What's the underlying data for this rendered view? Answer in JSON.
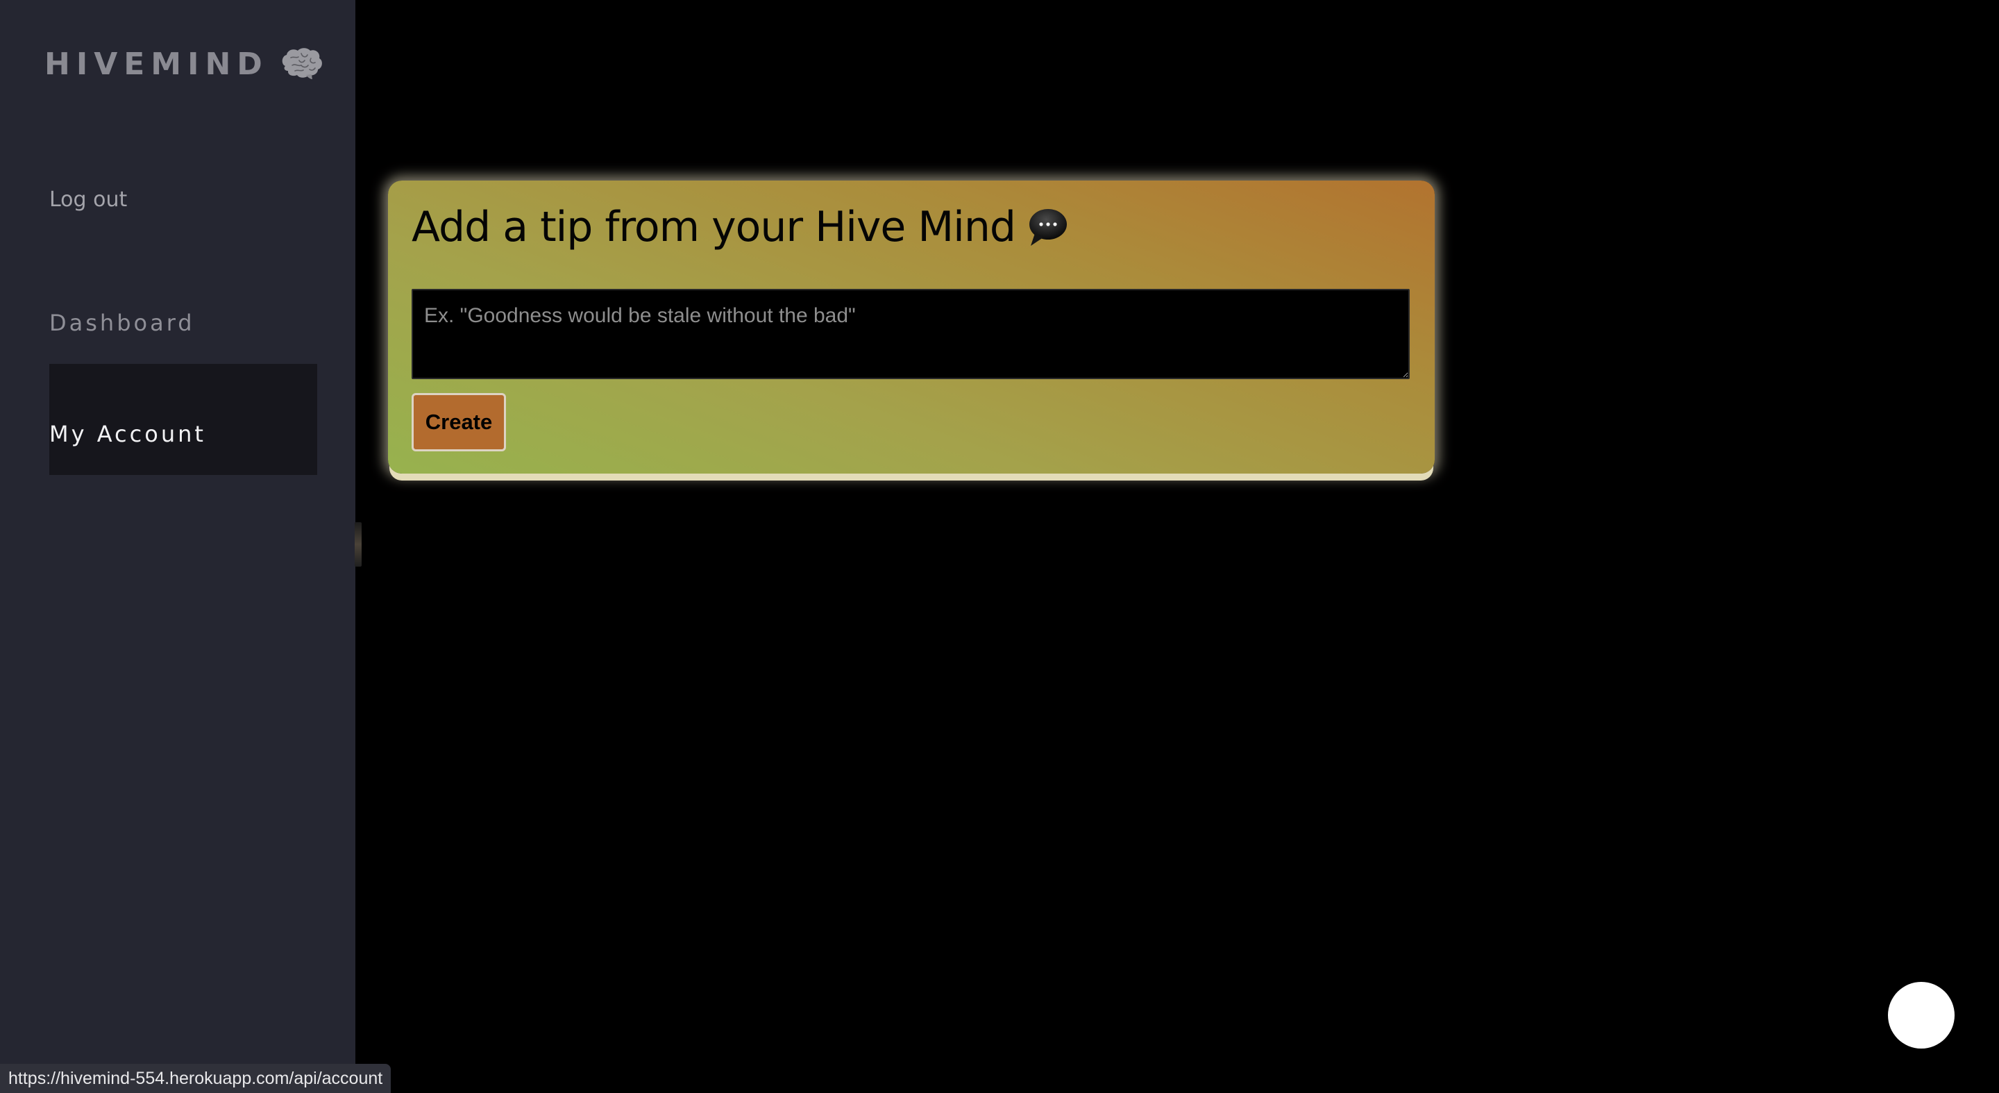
{
  "sidebar": {
    "brand": "HIVEMIND",
    "brand_icon": "brain-icon",
    "logout_label": "Log out",
    "nav": {
      "dashboard_label": "Dashboard",
      "account_label": "My Account"
    }
  },
  "tip_card": {
    "title": "Add a tip from your Hive Mind",
    "title_icon": "speech-bubble-icon",
    "input_placeholder": "Ex. \"Goodness would be stale without the bad\"",
    "input_value": "",
    "create_label": "Create"
  },
  "status_bar": {
    "url": "https://hivemind-554.herokuapp.com/api/account"
  },
  "colors": {
    "sidebar_bg": "#252631",
    "active_nav_bg": "#16161c",
    "page_bg": "#000000",
    "card_gradient_start": "#b2732f",
    "card_gradient_end": "#97b24e",
    "button_bg": "#b36b2e"
  }
}
